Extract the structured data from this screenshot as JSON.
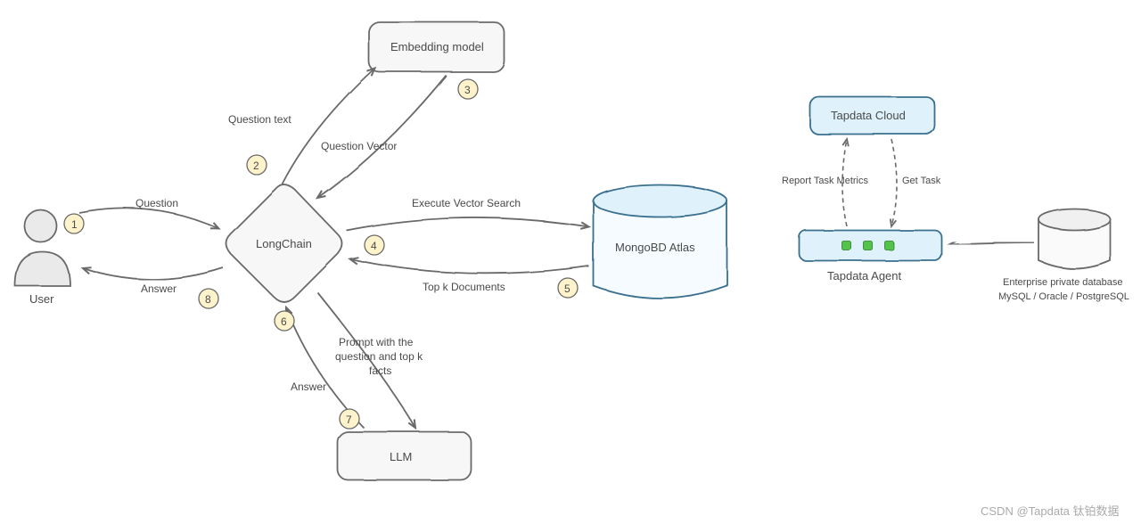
{
  "nodes": {
    "user": "User",
    "longchain": "LongChain",
    "embedding": "Embedding model",
    "mongo": "MongoBD Atlas",
    "llm": "LLM",
    "tapdata_cloud": "Tapdata Cloud",
    "tapdata_agent": "Tapdata Agent",
    "db_line1": "Enterprise private database",
    "db_line2": "MySQL / Oracle / PostgreSQL"
  },
  "edges": {
    "question": "Question",
    "answer_user": "Answer",
    "question_text": "Question text",
    "question_vector": "Question Vector",
    "exec_vector_search": "Execute Vector Search",
    "topk_docs": "Top k Documents",
    "prompt_line1": "Prompt with the",
    "prompt_line2": "question and top k",
    "prompt_line3": "facts",
    "answer_llm": "Answer",
    "report": "Report Task Metrics",
    "get_task": "Get Task"
  },
  "badges": {
    "b1": "1",
    "b2": "2",
    "b3": "3",
    "b4": "4",
    "b5": "5",
    "b6": "6",
    "b7": "7",
    "b8": "8"
  },
  "watermark": "CSDN @Tapdata 钛铂数据"
}
